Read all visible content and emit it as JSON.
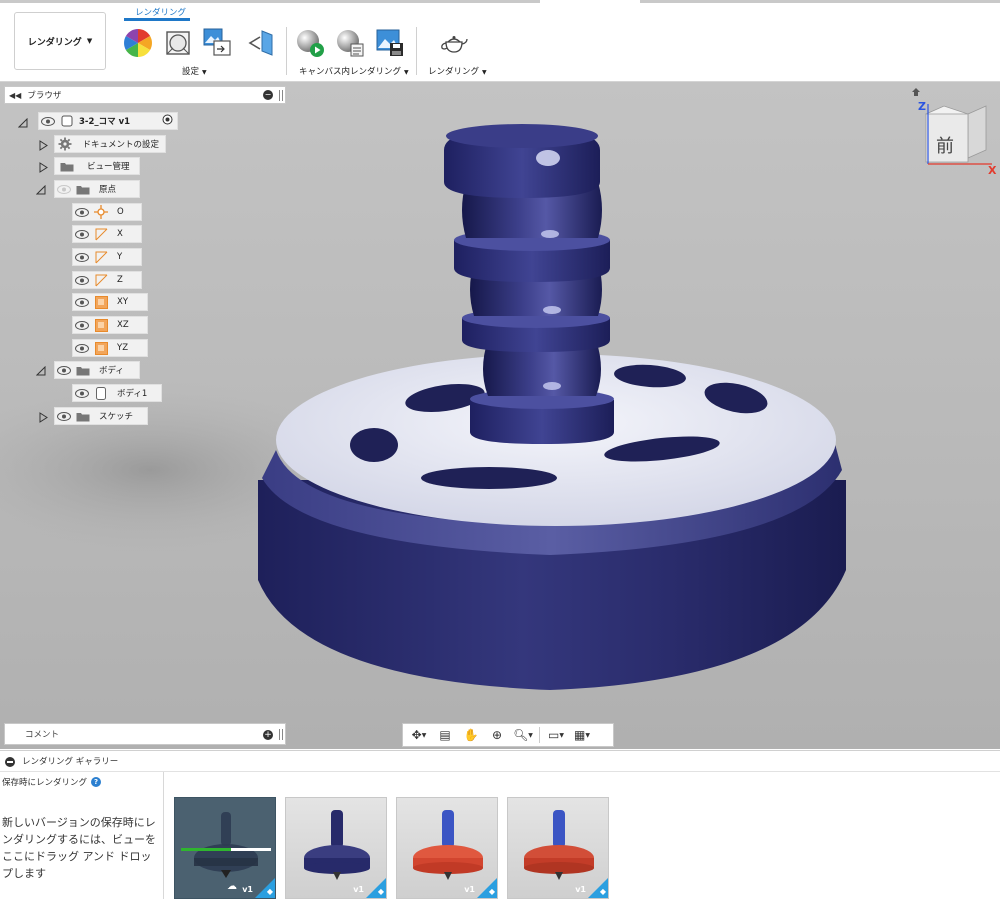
{
  "toolbar": {
    "workspace_label": "レンダリング",
    "active_tab": "レンダリング",
    "groups": [
      {
        "label": "設定"
      },
      {
        "label": "キャンバス内レンダリング"
      },
      {
        "label": "レンダリング"
      }
    ]
  },
  "browser": {
    "title": "ブラウザ",
    "root": "3-2_コマ v1",
    "items": [
      {
        "label": "ドキュメントの設定"
      },
      {
        "label": "ビュー管理"
      },
      {
        "label": "原点"
      },
      {
        "label": "O"
      },
      {
        "label": "X"
      },
      {
        "label": "Y"
      },
      {
        "label": "Z"
      },
      {
        "label": "XY"
      },
      {
        "label": "XZ"
      },
      {
        "label": "YZ"
      },
      {
        "label": "ボディ"
      },
      {
        "label": "ボディ1"
      },
      {
        "label": "スケッチ"
      }
    ]
  },
  "view_cube": {
    "face_label": "前",
    "axis_z": "Z",
    "axis_x": "X"
  },
  "comments": {
    "label": "コメント"
  },
  "gallery": {
    "title": "レンダリング ギャラリー",
    "save_label": "保存時にレンダリング",
    "help": "?",
    "hint": "新しいバージョンの保存時にレンダリングするには、ビューをここにドラッグ アンド ドロップします",
    "rendering_progress": 0.55,
    "thumbnails": [
      {
        "version": "v1",
        "colors": [
          "#2b2e66",
          "#2b2e66"
        ]
      },
      {
        "version": "v1",
        "colors": [
          "#272a6a",
          "#3a3d80"
        ]
      },
      {
        "version": "v1",
        "colors": [
          "#3b55c4",
          "#d2452f"
        ]
      },
      {
        "version": "v1",
        "colors": [
          "#3b55c4",
          "#c33c28"
        ]
      }
    ]
  },
  "colors": {
    "accent": "#1f78c8",
    "top_body": "#272a68",
    "top_face": "#e6e8f2",
    "progress": "#2fb52f"
  }
}
